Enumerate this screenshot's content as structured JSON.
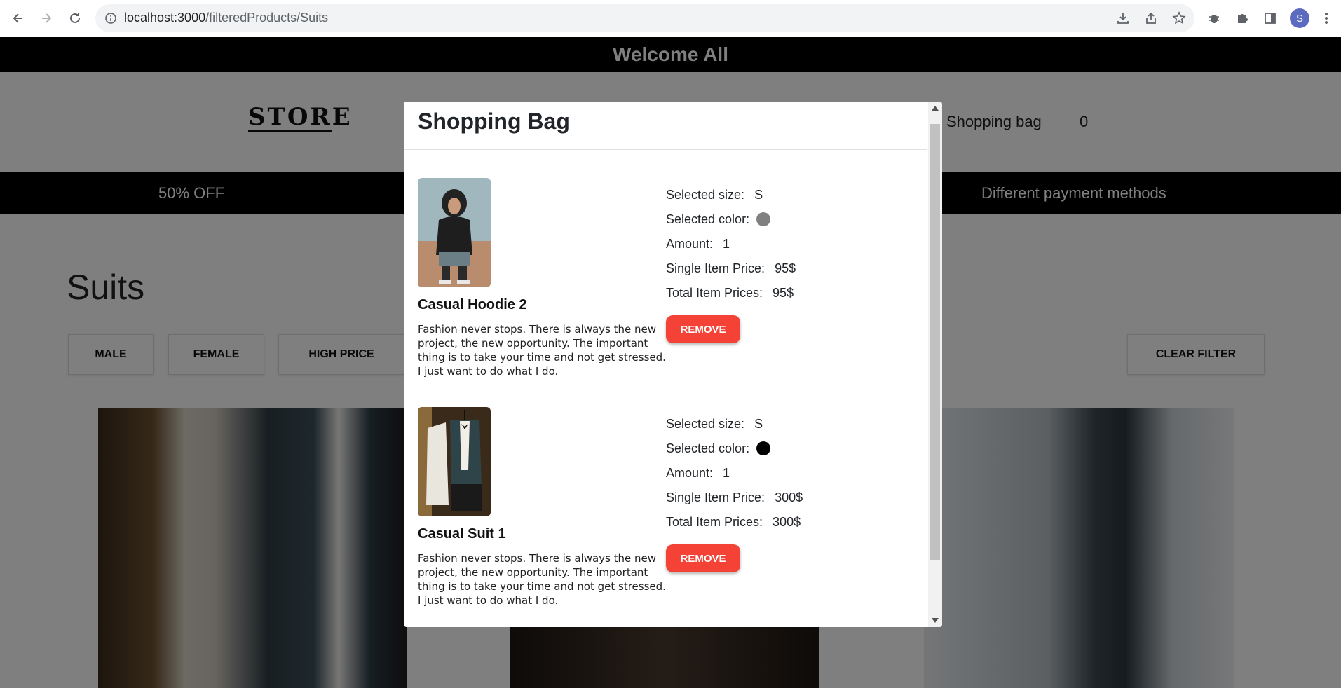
{
  "browser": {
    "url_host": "localhost:3000",
    "url_path": "/filteredProducts/Suits",
    "profile_initial": "S"
  },
  "page": {
    "welcome": "Welcome All",
    "logo": "STORE",
    "nav_bag_label": "Shopping bag",
    "nav_bag_count": "0",
    "promo_left": "50% OFF",
    "promo_right": "Different payment methods",
    "title": "Suits",
    "filters": [
      "MALE",
      "FEMALE",
      "HIGH PRICE"
    ],
    "clear_filter": "CLEAR FILTER"
  },
  "modal": {
    "title": "Shopping Bag",
    "labels": {
      "size": "Selected size:",
      "color": "Selected color:",
      "amount": "Amount:",
      "single_price": "Single Item Price:",
      "total_price": "Total Item Prices:",
      "remove": "REMOVE"
    },
    "items": [
      {
        "name": "Casual Hoodie 2",
        "description": "Fashion never stops. There is always the new project, the new opportunity. The important thing is to take your time and not get stressed. I just want to do what I do.",
        "size": "S",
        "color": "#808080",
        "amount": "1",
        "single_price": "95$",
        "total_price": "95$"
      },
      {
        "name": "Casual Suit 1",
        "description": "Fashion never stops. There is always the new project, the new opportunity. The important thing is to take your time and not get stressed. I just want to do what I do.",
        "size": "S",
        "color": "#000000",
        "amount": "1",
        "single_price": "300$",
        "total_price": "300$"
      }
    ]
  }
}
